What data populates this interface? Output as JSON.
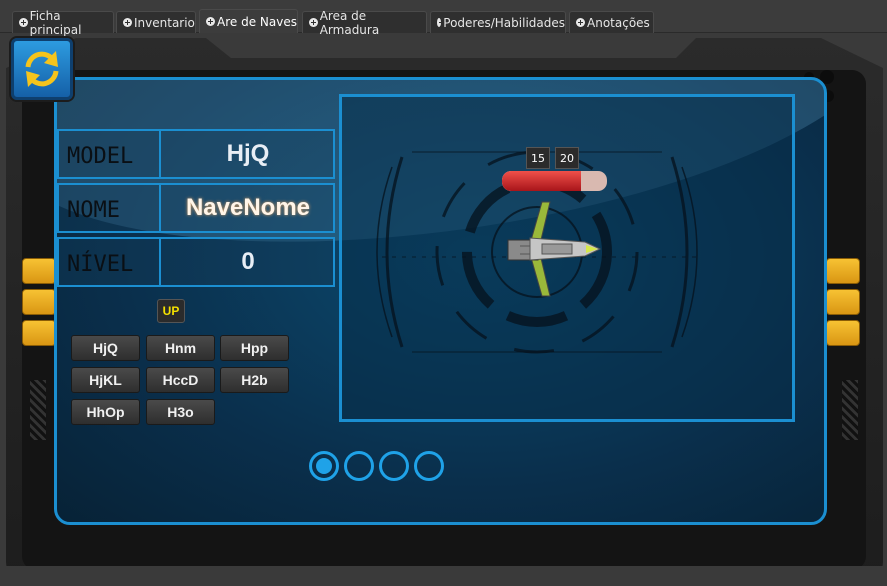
{
  "tabs": [
    {
      "label": "Ficha principal",
      "active": false
    },
    {
      "label": "Inventario",
      "active": false
    },
    {
      "label": "Are de Naves",
      "active": true
    },
    {
      "label": "Area de Armadura",
      "active": false
    },
    {
      "label": "Poderes/Habilidades",
      "active": false
    },
    {
      "label": "Anotações",
      "active": false
    }
  ],
  "info": {
    "model_label": "MODEL",
    "model_value": "HjQ",
    "nome_label": "NOME",
    "nome_value": "NaveNome",
    "nivel_label": "NÍVEL",
    "nivel_value": "0"
  },
  "up_label": "UP",
  "ship_buttons": [
    "HjQ",
    "Hnm",
    "Hpp",
    "HjKL",
    "HccD",
    "H2b",
    "HhOp",
    "H3o"
  ],
  "hp": {
    "current": "15",
    "max": "20",
    "fraction": 0.75
  },
  "pager": {
    "count": 4,
    "active_index": 0
  },
  "icons": {
    "refresh": "refresh-icon",
    "ship": "spaceship-icon"
  },
  "colors": {
    "accent": "#1b8fd1",
    "screen": "#0a2f4c",
    "hp_fill": "#d42a2a",
    "up_text": "#f5e100"
  }
}
